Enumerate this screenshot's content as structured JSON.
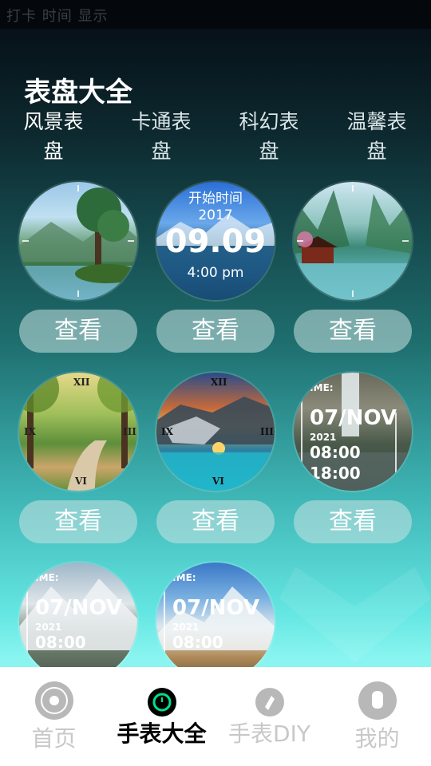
{
  "status_bar": {
    "left_text": "打卡 时间 显示",
    "right_text": "",
    "bg": "#04070c"
  },
  "page": {
    "title": "表盘大全"
  },
  "tabs": [
    {
      "line1": "风景表",
      "line2": "盘",
      "active": true
    },
    {
      "line1": "卡通表",
      "line2": "盘",
      "active": false
    },
    {
      "line1": "科幻表",
      "line2": "盘",
      "active": false
    },
    {
      "line1": "温馨表",
      "line2": "盘",
      "active": false
    }
  ],
  "dials": [
    {
      "name": "lake-tree-dial",
      "theme": "analog-landscape"
    },
    {
      "name": "digital-lake-dial",
      "top_text": "开始时间",
      "year": "2017",
      "time": "09.09",
      "sub": "4:00 pm"
    },
    {
      "name": "river-pavilion-dial",
      "theme": "analog-landscape"
    },
    {
      "name": "forest-path-dial",
      "theme": "roman-analog"
    },
    {
      "name": "island-sunset-dial",
      "theme": "roman-analog"
    },
    {
      "name": "waterfall-date-dial",
      "label": "TIME:",
      "date": "07/NOV",
      "year": "2021",
      "time1": "08:00",
      "time2": "18:00"
    },
    {
      "name": "mountain-date-dial-1",
      "label": "TIME:",
      "date": "07/NOV",
      "year": "2021",
      "time1": "08:00"
    },
    {
      "name": "mountain-date-dial-2",
      "label": "TIME:",
      "date": "07/NOV",
      "year": "2021",
      "time1": "08:00"
    }
  ],
  "view_button_label": "查看",
  "bottom_nav": [
    {
      "label": "首页",
      "icon": "home-icon",
      "active": false
    },
    {
      "label": "手表大全",
      "icon": "watch-icon",
      "active": true
    },
    {
      "label": "手表DIY",
      "icon": "diy-icon",
      "active": false
    },
    {
      "label": "我的",
      "icon": "profile-icon",
      "active": false
    }
  ],
  "colors": {
    "accent": "#00e08a",
    "nav_inactive": "#c8c8c8",
    "button_bg": "rgba(200,225,225,0.55)"
  }
}
